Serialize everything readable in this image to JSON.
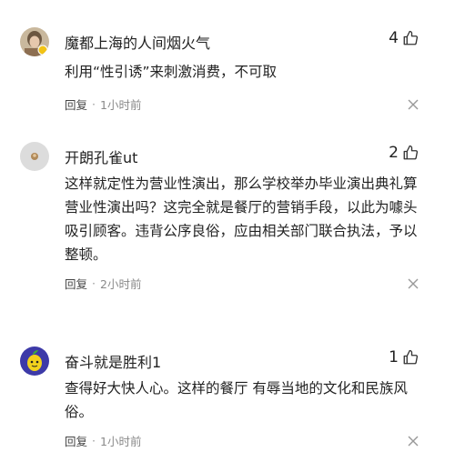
{
  "comments": [
    {
      "username": "魔都上海的人间烟火气",
      "likes": "4",
      "text": "利用“性引诱”来刺激消费，不可取",
      "reply_label": "回复",
      "separator": "·",
      "time": "1小时前"
    },
    {
      "username": "开朗孔雀ut",
      "likes": "2",
      "text": "这样就定性为营业性演出，那么学校举办毕业演出典礼算营业性演出吗？这完全就是餐厅的营销手段，以此为噱头吸引顾客。违背公序良俗，应由相关部门联合执法，予以整顿。",
      "reply_label": "回复",
      "separator": "·",
      "time": "2小时前"
    },
    {
      "username": "奋斗就是胜利1",
      "likes": "1",
      "text": "查得好大快人心。这样的餐厅 有辱当地的文化和民族风俗。",
      "reply_label": "回复",
      "separator": "·",
      "time": "1小时前"
    }
  ],
  "icons": {
    "like": "thumbs-up-icon",
    "close": "close-icon"
  },
  "colors": {
    "text": "#222222",
    "meta": "#8a8a8a",
    "background": "#ffffff"
  }
}
